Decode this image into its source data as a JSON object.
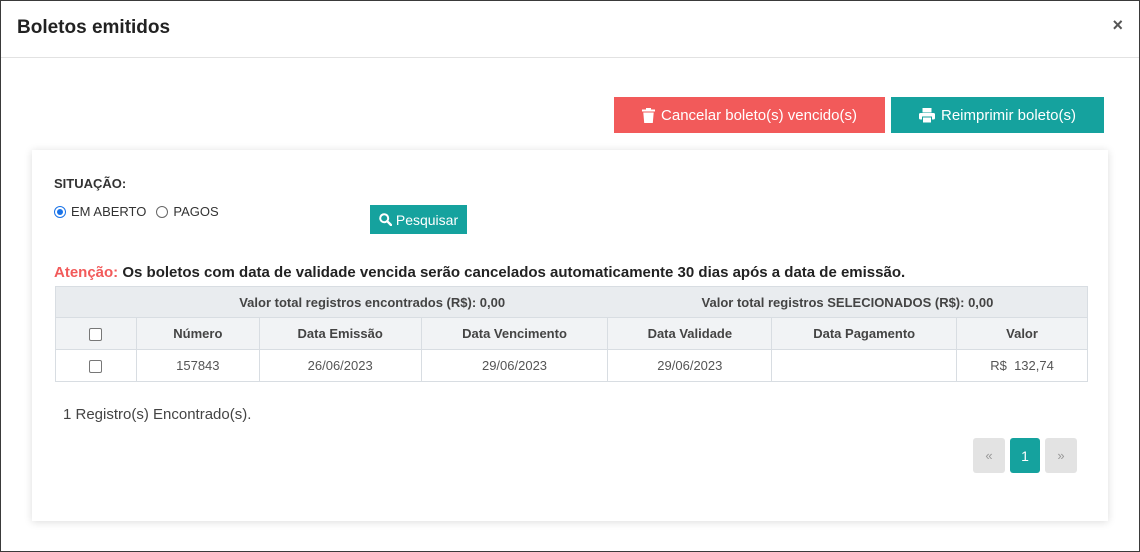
{
  "modal": {
    "title": "Boletos emitidos",
    "close_label": "×"
  },
  "actions": {
    "cancel_label": "Cancelar boleto(s) vencido(s)",
    "reprint_label": "Reimprimir boleto(s)"
  },
  "filter": {
    "label": "SITUAÇÃO:",
    "options": [
      {
        "label": "EM ABERTO",
        "selected": true
      },
      {
        "label": "PAGOS",
        "selected": false
      }
    ],
    "search_label": "Pesquisar"
  },
  "warning": {
    "label": "Atenção:",
    "text": " Os boletos com data de validade vencida serão cancelados automaticamente 30 dias após a data de emissão."
  },
  "table": {
    "total_found": "Valor total registros encontrados (R$): 0,00",
    "total_selected": "Valor total registros SELECIONADOS (R$): 0,00",
    "columns": [
      "Número",
      "Data Emissão",
      "Data Vencimento",
      "Data Validade",
      "Data Pagamento",
      "Valor"
    ],
    "rows": [
      {
        "numero": "157843",
        "emissao": "26/06/2023",
        "vencimento": "29/06/2023",
        "validade": "29/06/2023",
        "pagamento": "",
        "valor": "R$  132,74"
      }
    ]
  },
  "footer": {
    "count_text": "1 Registro(s) Encontrado(s)."
  },
  "pagination": {
    "prev": "«",
    "current": "1",
    "next": "»"
  },
  "colors": {
    "danger": "#f25a5a",
    "teal": "#15a29e"
  }
}
